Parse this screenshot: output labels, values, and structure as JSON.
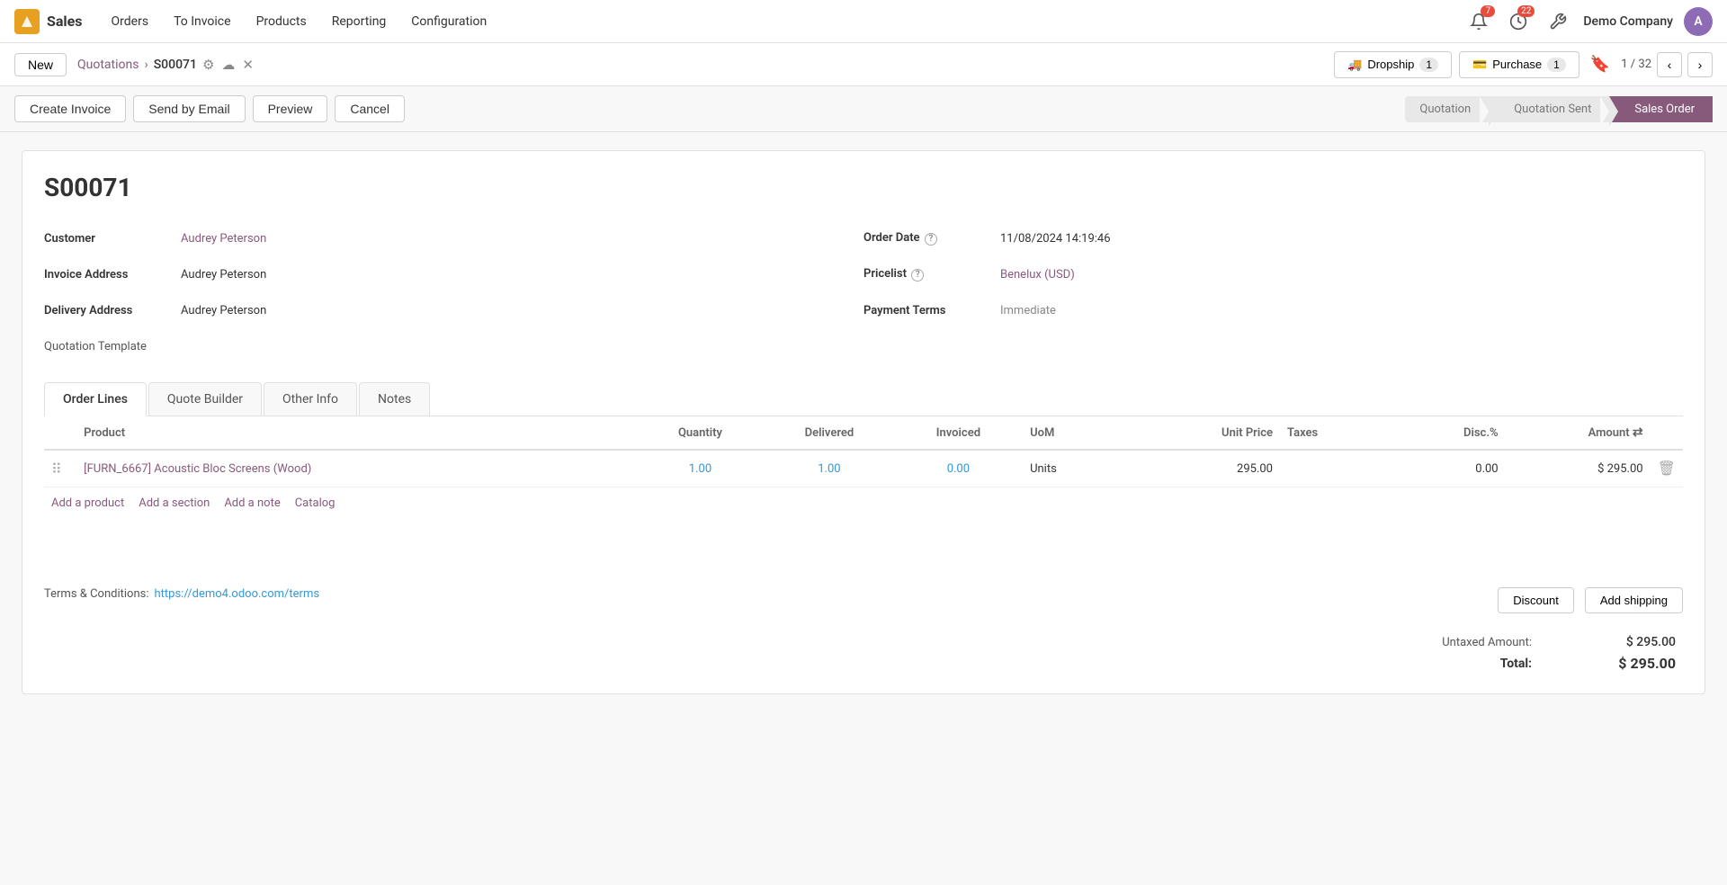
{
  "app": {
    "brand": "Sales",
    "brand_icon_color": "#e8a020"
  },
  "navbar": {
    "items": [
      {
        "label": "Sales",
        "key": "sales"
      },
      {
        "label": "Orders",
        "key": "orders"
      },
      {
        "label": "To Invoice",
        "key": "to-invoice"
      },
      {
        "label": "Products",
        "key": "products"
      },
      {
        "label": "Reporting",
        "key": "reporting"
      },
      {
        "label": "Configuration",
        "key": "configuration"
      }
    ],
    "notifications_badge": "7",
    "messages_badge": "22",
    "company": "Demo Company"
  },
  "breadcrumb": {
    "new_label": "New",
    "parent_label": "Quotations",
    "current_label": "S00071",
    "record_count": "1 / 32"
  },
  "status_buttons": {
    "dropship": {
      "label": "Dropship",
      "count": "1"
    },
    "purchase": {
      "label": "Purchase",
      "count": "1"
    }
  },
  "actions": {
    "create_invoice": "Create Invoice",
    "send_by_email": "Send by Email",
    "preview": "Preview",
    "cancel": "Cancel"
  },
  "pipeline": {
    "steps": [
      {
        "label": "Quotation",
        "key": "quotation"
      },
      {
        "label": "Quotation Sent",
        "key": "quotation-sent"
      },
      {
        "label": "Sales Order",
        "key": "sales-order",
        "active": true
      }
    ]
  },
  "document": {
    "title": "S00071",
    "customer_label": "Customer",
    "customer_value": "Audrey Peterson",
    "invoice_address_label": "Invoice Address",
    "invoice_address_value": "Audrey Peterson",
    "delivery_address_label": "Delivery Address",
    "delivery_address_value": "Audrey Peterson",
    "quotation_template_label": "Quotation Template",
    "order_date_label": "Order Date",
    "order_date_value": "11/08/2024 14:19:46",
    "pricelist_label": "Pricelist",
    "pricelist_value": "Benelux (USD)",
    "payment_terms_label": "Payment Terms",
    "payment_terms_value": "Immediate"
  },
  "tabs": [
    {
      "label": "Order Lines",
      "key": "order-lines",
      "active": true
    },
    {
      "label": "Quote Builder",
      "key": "quote-builder"
    },
    {
      "label": "Other Info",
      "key": "other-info"
    },
    {
      "label": "Notes",
      "key": "notes"
    }
  ],
  "table": {
    "headers": [
      {
        "label": "Product",
        "key": "product"
      },
      {
        "label": "Quantity",
        "key": "quantity"
      },
      {
        "label": "Delivered",
        "key": "delivered"
      },
      {
        "label": "Invoiced",
        "key": "invoiced"
      },
      {
        "label": "UoM",
        "key": "uom"
      },
      {
        "label": "Unit Price",
        "key": "unit-price"
      },
      {
        "label": "Taxes",
        "key": "taxes"
      },
      {
        "label": "Disc.%",
        "key": "disc"
      },
      {
        "label": "Amount",
        "key": "amount"
      }
    ],
    "rows": [
      {
        "product": "[FURN_6667] Acoustic Bloc Screens (Wood)",
        "quantity": "1.00",
        "delivered": "1.00",
        "invoiced": "0.00",
        "uom": "Units",
        "unit_price": "295.00",
        "taxes": "",
        "disc": "0.00",
        "amount": "$ 295.00"
      }
    ],
    "add_product": "Add a product",
    "add_section": "Add a section",
    "add_note": "Add a note",
    "catalog": "Catalog"
  },
  "footer": {
    "terms_label": "Terms & Conditions:",
    "terms_link": "https://demo4.odoo.com/terms",
    "discount_btn": "Discount",
    "add_shipping_btn": "Add shipping",
    "untaxed_amount_label": "Untaxed Amount:",
    "untaxed_amount_value": "$ 295.00",
    "total_label": "Total:",
    "total_value": "$ 295.00"
  }
}
